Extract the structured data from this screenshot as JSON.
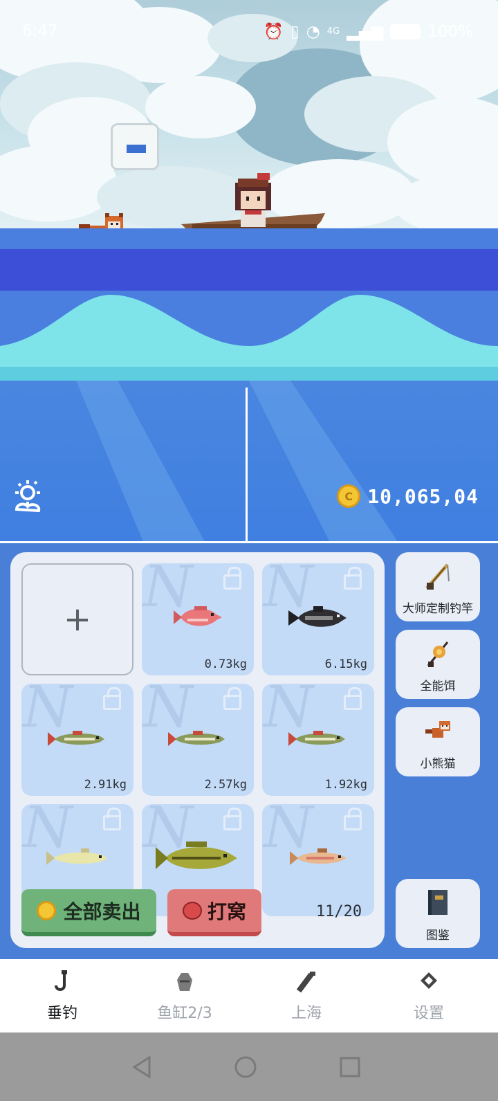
{
  "status_bar": {
    "time": "6:47",
    "network": "4G",
    "battery": "100%"
  },
  "scene": {
    "weather_icon": "sunny-cloud-icon",
    "coins": "10,065,",
    "coins_suffix": "04"
  },
  "inventory": {
    "add_slot_label": "+",
    "slots": [
      {
        "fish": "red-snapper",
        "weight": "0.73kg"
      },
      {
        "fish": "catfish",
        "weight": "6.15kg"
      },
      {
        "fish": "pike",
        "weight": "2.91kg"
      },
      {
        "fish": "pike",
        "weight": "2.57kg"
      },
      {
        "fish": "pike",
        "weight": "1.92kg"
      },
      {
        "fish": "pale-fish",
        "weight": ""
      },
      {
        "fish": "bass",
        "weight": ""
      },
      {
        "fish": "trout",
        "weight": ""
      }
    ],
    "sell_all_label": "全部卖出",
    "bait_label": "打窝",
    "capacity": "11/20"
  },
  "side_panel": {
    "rod_label": "大师定制钓竿",
    "bait_label": "全能饵",
    "pet_label": "小熊猫",
    "encyclopedia_label": "图鉴"
  },
  "bottom_nav": {
    "items": [
      {
        "label": "垂钓",
        "icon": "fishing-hook-icon",
        "active": true
      },
      {
        "label": "鱼缸2/3",
        "icon": "fish-tank-icon",
        "active": false
      },
      {
        "label": "上海",
        "icon": "location-icon",
        "active": false
      },
      {
        "label": "设置",
        "icon": "gear-icon",
        "active": false
      }
    ]
  },
  "colors": {
    "sea_deep": "#3a3ed0",
    "wave": "#7ee4ea",
    "panel": "#4a7fd8",
    "sell_button": "#6fb37a",
    "bait_button": "#e07a7a"
  }
}
